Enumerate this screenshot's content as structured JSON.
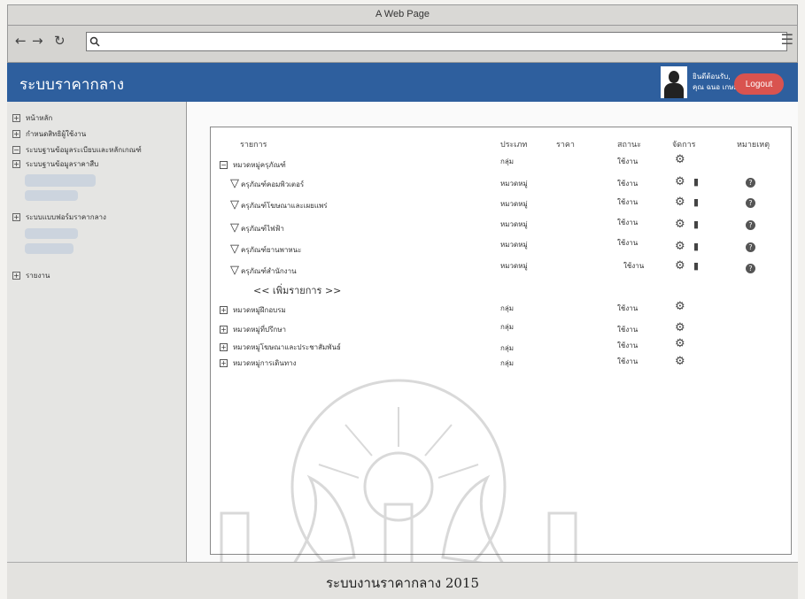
{
  "window": {
    "title": "A Web Page"
  },
  "browser": {
    "back": "←",
    "forward": "→",
    "reload": "↻",
    "search_icon": "🔍",
    "url": "",
    "menu": "☰"
  },
  "app": {
    "title": "ระบบราคากลาง",
    "user_line1": "ยินดีต้อนรับ,",
    "user_line2": "คุณ ฉนอ เกษมสุข",
    "logout": "Logout"
  },
  "sidebar": {
    "items": [
      {
        "icon": "⊞",
        "label": "หน้าหลัก"
      },
      {
        "icon": "⊞",
        "label": "กำหนดสิทธิผู้ใช้งาน"
      },
      {
        "icon": "⊟",
        "label": "ระบบฐานข้อมูลระเบียบและหลักเกณฑ์"
      },
      {
        "icon": "⊞",
        "label": "ระบบฐานข้อมูลราคาสืบ"
      },
      {
        "icon": "⊞",
        "label": "ระบบแบบฟอร์มราคากลาง"
      },
      {
        "icon": "⊞",
        "label": "รายงาน"
      }
    ]
  },
  "table": {
    "headers": {
      "name": "รายการ",
      "type": "ประเภท",
      "price": "ราคา",
      "status": "สถานะ",
      "manage": "จัดการ",
      "note": "หมายเหตุ"
    },
    "groups": [
      {
        "name": "หมวดหมู่ครุภัณฑ์",
        "type": "กลุ่ม",
        "status": "ใช้งาน"
      }
    ],
    "subitems": [
      {
        "name": "ครุภัณฑ์คอมพิวเตอร์",
        "type": "หมวดหมู่",
        "status": "ใช้งาน"
      },
      {
        "name": "ครุภัณฑ์โฆษณาและเผยแพร่",
        "type": "หมวดหมู่",
        "status": "ใช้งาน"
      },
      {
        "name": "ครุภัณฑ์ไฟฟ้า",
        "type": "หมวดหมู่",
        "status": "ใช้งาน"
      },
      {
        "name": "ครุภัณฑ์ยานพาหนะ",
        "type": "หมวดหมู่",
        "status": "ใช้งาน"
      },
      {
        "name": "ครุภัณฑ์สำนักงาน",
        "type": "หมวดหมู่",
        "status": "ใช้งาน"
      }
    ],
    "add_item": "<< เพิ่มรายการ >>",
    "other_groups": [
      {
        "name": "หมวดหมู่ฝึกอบรม",
        "type": "กลุ่ม",
        "status": "ใช้งาน"
      },
      {
        "name": "หมวดหมู่ที่ปรึกษา",
        "type": "กลุ่ม",
        "status": "ใช้งาน"
      },
      {
        "name": "หมวดหมู่โฆษณาและประชาสัมพันธ์",
        "type": "กลุ่ม",
        "status": "ใช้งาน"
      },
      {
        "name": "หมวดหมู่การเดินทาง",
        "type": "กลุ่ม",
        "status": "ใช้งาน"
      }
    ]
  },
  "footer": {
    "text": "ระบบงานราคากลาง 2015"
  },
  "icons": {
    "gear": "⚙",
    "trash": "🗑",
    "help": "?",
    "triangle": "▽",
    "collapse": "−",
    "expand": "+"
  }
}
